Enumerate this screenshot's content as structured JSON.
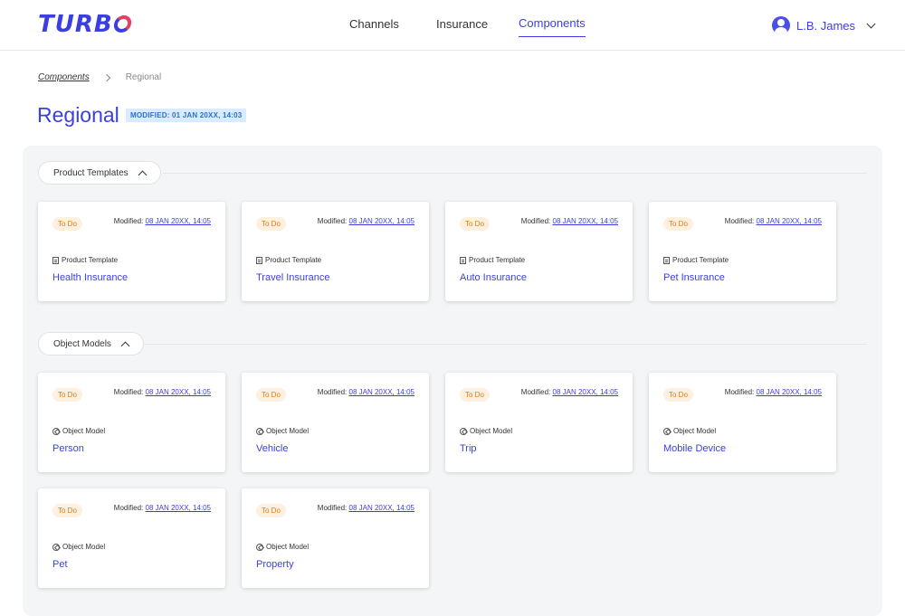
{
  "header": {
    "logo": "TURB",
    "nav": [
      {
        "label": "Channels"
      },
      {
        "label": "Insurance"
      },
      {
        "label": "Components"
      }
    ],
    "active_nav": "Components",
    "user_name": "L.B. James"
  },
  "breadcrumb": {
    "link": "Components",
    "current": "Regional"
  },
  "page": {
    "title": "Regional",
    "modified_badge": "MODIFIED: 01 JAN 20XX, 14:03"
  },
  "sections": [
    {
      "label": "Product Templates",
      "cards": [
        {
          "status": "To Do",
          "modified_label": "Modified:",
          "modified_date": "08 JAN 20XX, 14:05",
          "type": "Product Template",
          "title": "Health Insurance"
        },
        {
          "status": "To Do",
          "modified_label": "Modified:",
          "modified_date": "08 JAN 20XX, 14:05",
          "type": "Product Template",
          "title": "Travel Insurance"
        },
        {
          "status": "To Do",
          "modified_label": "Modified:",
          "modified_date": "08 JAN 20XX, 14:05",
          "type": "Product Template",
          "title": "Auto Insurance"
        },
        {
          "status": "To Do",
          "modified_label": "Modified:",
          "modified_date": "08 JAN 20XX, 14:05",
          "type": "Product Template",
          "title": "Pet Insurance"
        }
      ]
    },
    {
      "label": "Object Models",
      "cards": [
        {
          "status": "To Do",
          "modified_label": "Modified:",
          "modified_date": "08 JAN 20XX, 14:05",
          "type": "Object Model",
          "title": "Person"
        },
        {
          "status": "To Do",
          "modified_label": "Modified:",
          "modified_date": "08 JAN 20XX, 14:05",
          "type": "Object Model",
          "title": "Vehicle"
        },
        {
          "status": "To Do",
          "modified_label": "Modified:",
          "modified_date": "08 JAN 20XX, 14:05",
          "type": "Object Model",
          "title": "Trip"
        },
        {
          "status": "To Do",
          "modified_label": "Modified:",
          "modified_date": "08 JAN 20XX, 14:05",
          "type": "Object Model",
          "title": "Mobile Device"
        },
        {
          "status": "To Do",
          "modified_label": "Modified:",
          "modified_date": "08 JAN 20XX, 14:05",
          "type": "Object Model",
          "title": "Pet"
        },
        {
          "status": "To Do",
          "modified_label": "Modified:",
          "modified_date": "08 JAN 20XX, 14:05",
          "type": "Object Model",
          "title": "Property"
        }
      ]
    }
  ],
  "colors": {
    "accent": "#3b3fe0",
    "status_todo_bg": "#fdf0e0",
    "status_todo_text": "#e07b15",
    "badge_bg": "#d9ecff"
  }
}
